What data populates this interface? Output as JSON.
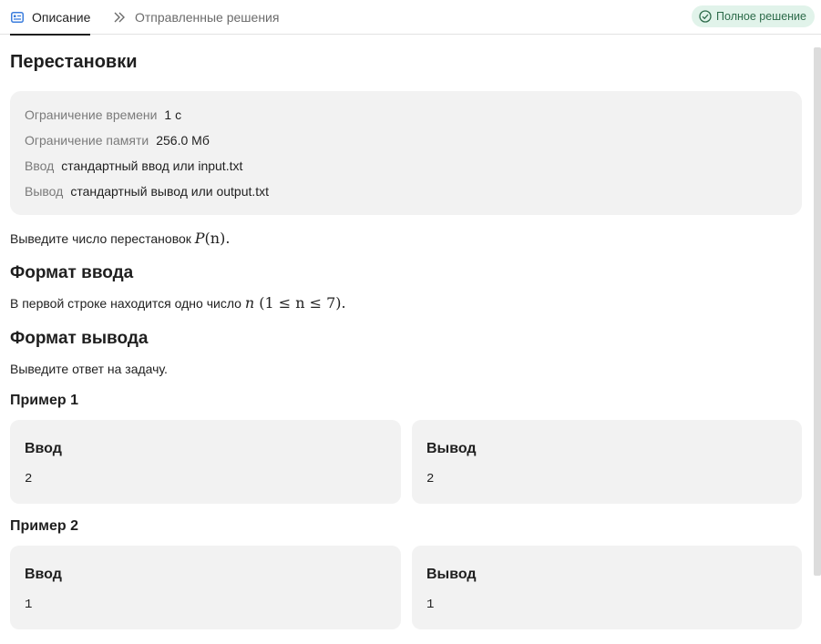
{
  "tabs": {
    "description": "Описание",
    "submissions": "Отправленные решения",
    "status_badge": "Полное решение"
  },
  "colors": {
    "badge_bg": "#e1f3ea",
    "badge_text": "#2d6b4a",
    "panel_bg": "#f2f2f2"
  },
  "problem": {
    "title": "Перестановки",
    "limits": [
      {
        "label": "Ограничение времени",
        "value": "1 с"
      },
      {
        "label": "Ограничение памяти",
        "value": "256.0 Мб"
      },
      {
        "label": "Ввод",
        "value": "стандартный ввод или input.txt"
      },
      {
        "label": "Вывод",
        "value": "стандартный вывод или output.txt"
      }
    ],
    "statement_text": "Выведите число перестановок ",
    "statement_math": "P",
    "statement_math_arg": "(n).",
    "input_heading": "Формат ввода",
    "input_text": "В первой строке находится одно число ",
    "input_math_var": "n",
    "input_math_range": "(1 ≤ n ≤ 7).",
    "output_heading": "Формат вывода",
    "output_text": "Выведите ответ на задачу.",
    "examples": [
      {
        "heading": "Пример 1",
        "input_label": "Ввод",
        "input": "2",
        "output_label": "Вывод",
        "output": "2"
      },
      {
        "heading": "Пример 2",
        "input_label": "Ввод",
        "input": "1",
        "output_label": "Вывод",
        "output": "1"
      }
    ]
  },
  "icons": {
    "description_tab": "document-list-icon",
    "submissions_tab": "double-chevron-right-icon",
    "status": "check-circle-icon"
  }
}
